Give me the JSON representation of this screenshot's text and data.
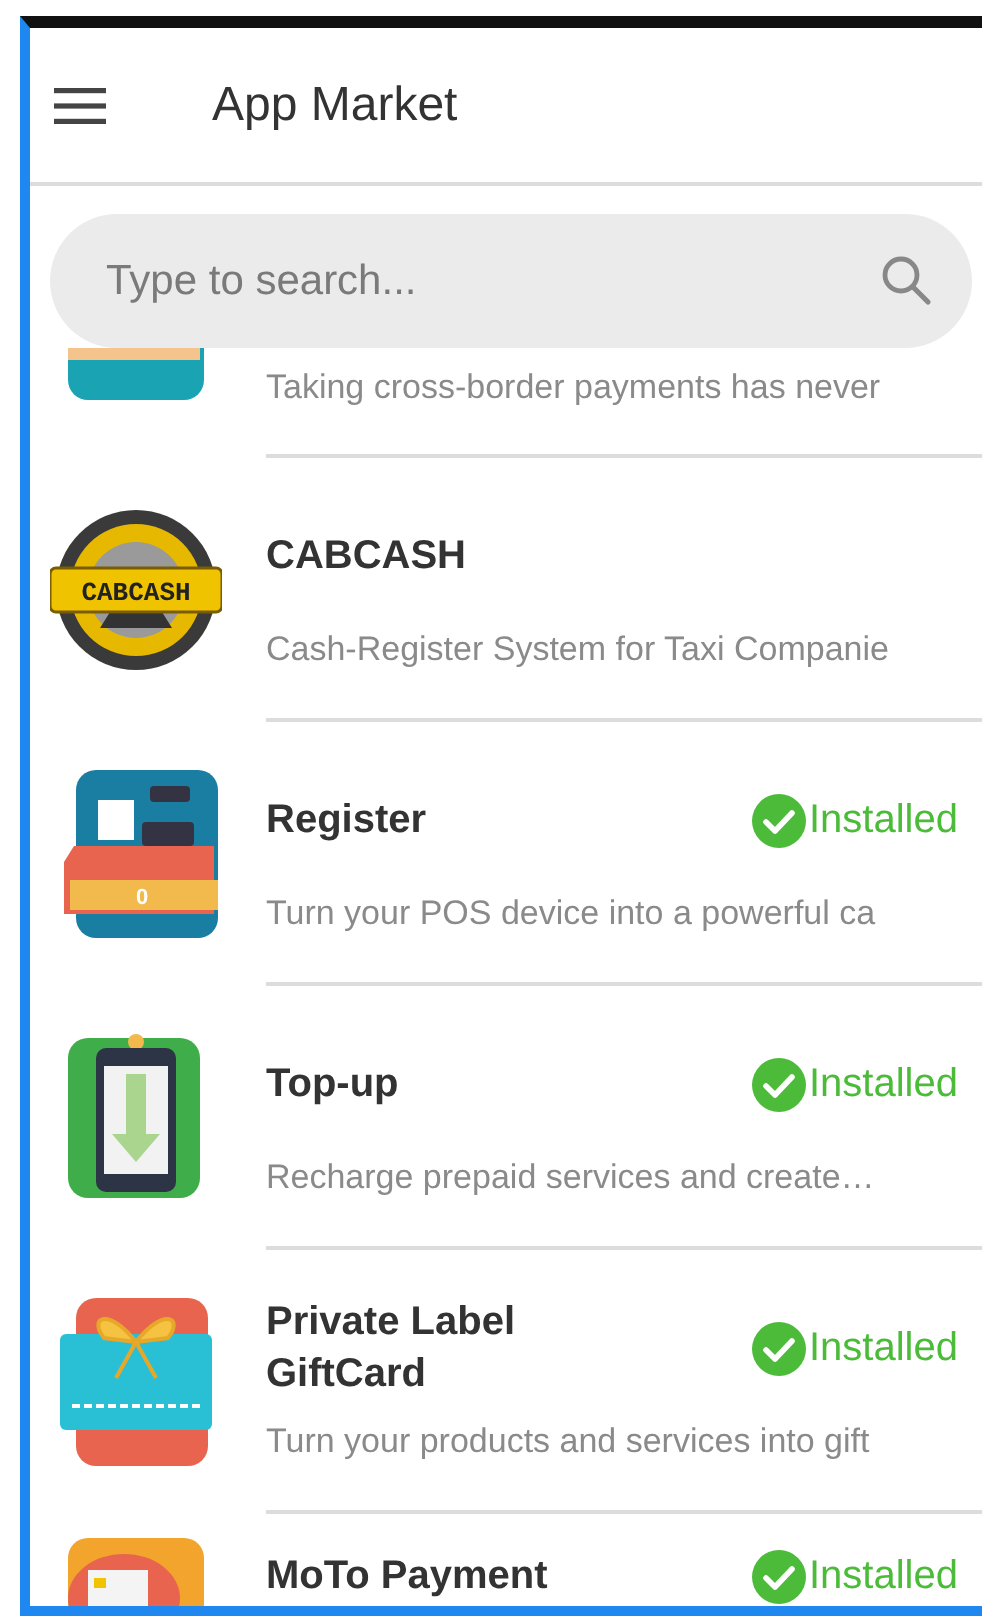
{
  "header": {
    "title": "App Market"
  },
  "search": {
    "placeholder": "Type to search..."
  },
  "apps": [
    {
      "kind": "cut_top",
      "description": "Taking cross-border payments has never",
      "installed": false
    },
    {
      "kind": "full",
      "name": "CABCASH",
      "logo_text": "CABCASH",
      "description": "Cash-Register System for Taxi Companie",
      "installed": false
    },
    {
      "kind": "full",
      "name": "Register",
      "logo_text": "0",
      "description": "Turn your POS device into a powerful ca",
      "installed": true,
      "status": "Installed"
    },
    {
      "kind": "full",
      "name": "Top-up",
      "description": "Recharge prepaid services and create…",
      "installed": true,
      "status": "Installed"
    },
    {
      "kind": "full",
      "name": "Private Label GiftCard",
      "description": "Turn your products and services into gift",
      "installed": true,
      "status": "Installed"
    },
    {
      "kind": "cut_bottom",
      "name": "MoTo Payment",
      "installed": true,
      "status": "Installed"
    }
  ]
}
